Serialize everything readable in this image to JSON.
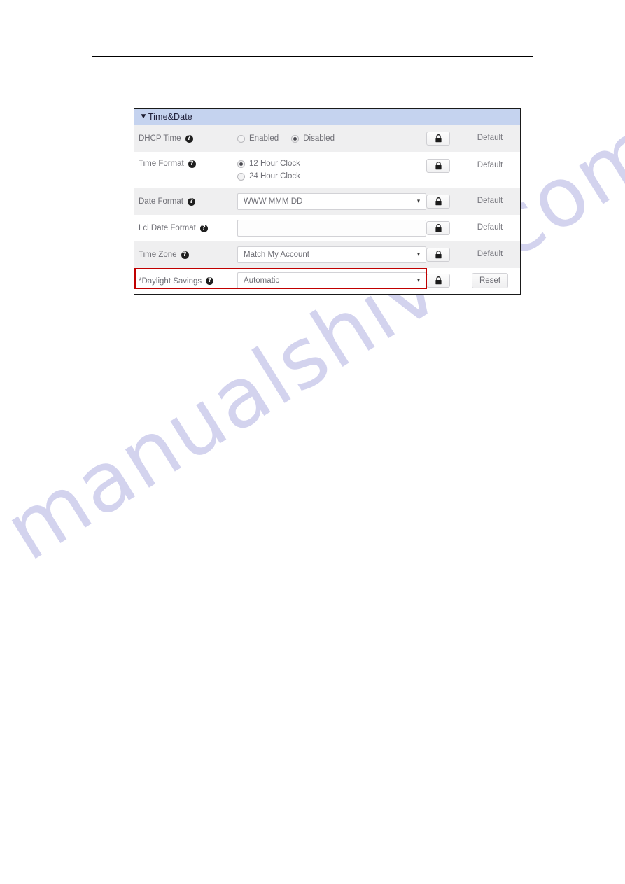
{
  "page": {
    "watermark_text": "manualshive.com",
    "watermark_color": "#ccccec"
  },
  "panel": {
    "header": {
      "title": "Time&Date",
      "chevron": "▼",
      "background_color": "#c5d3ef"
    },
    "lock_label": "lock",
    "rows": [
      {
        "label": "DHCP Time",
        "help": "?",
        "control_type": "radio",
        "options": [
          {
            "label": "Enabled",
            "selected": false
          },
          {
            "label": "Disabled",
            "selected": true
          }
        ],
        "action": "Default"
      },
      {
        "label": "Time Format",
        "help": "?",
        "control_type": "radio-stacked",
        "options": [
          {
            "label": "12 Hour Clock",
            "selected": true
          },
          {
            "label": "24 Hour Clock",
            "selected": false
          }
        ],
        "action": "Default"
      },
      {
        "label": "Date Format",
        "help": "?",
        "control_type": "select",
        "value": "WWW MMM DD",
        "caret": "▼",
        "action": "Default"
      },
      {
        "label": "Lcl Date Format",
        "help": "?",
        "control_type": "text",
        "value": "",
        "placeholder": "",
        "action": "Default"
      },
      {
        "label": "Time Zone",
        "help": "?",
        "control_type": "select",
        "value": "Match My Account",
        "caret": "▼",
        "action": "Default"
      },
      {
        "label": "*Daylight Savings",
        "help": "?",
        "control_type": "select",
        "value": "Automatic",
        "caret": "▼",
        "action": "Reset",
        "highlighted": true,
        "highlight_color": "#c00000"
      }
    ]
  }
}
